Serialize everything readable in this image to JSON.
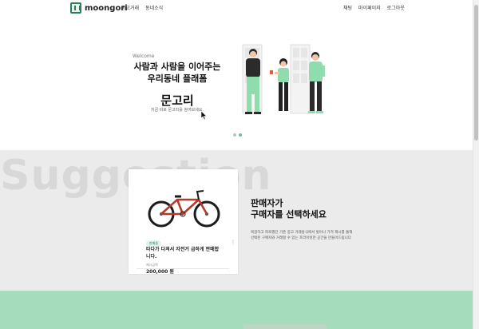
{
  "header": {
    "brand_name": "moongori",
    "nav_left": [
      "중고거래",
      "동네소식"
    ],
    "nav_right": [
      "채팅",
      "마이페이지",
      "로그아웃"
    ]
  },
  "hero": {
    "welcome": "Welcome",
    "title_line1": "사람과 사람을 이어주는",
    "title_line2": "우리동네 플래폼",
    "brand": "문고리",
    "subtitle": "지금 바로 문고리를 참여보세요.",
    "slide_count": 2,
    "active_slide": 2
  },
  "suggestion": {
    "background_word": "Suggestion",
    "card": {
      "badge": "판매중",
      "title": "타다가 다쳐서 자전거 급하게 판매합니다.",
      "price_label": "제시금액",
      "price": "200,000 원"
    },
    "heading_line1": "판매자가",
    "heading_line2": "구매자를 선택하세요",
    "description": "복잡하고 피로했던 기존 중고 거래방식에서 벗어나 가격 제시를 통해 선택된 구매자와 거래할 수 있는 프라이빗한 공간을 만들어드립니다"
  },
  "colors": {
    "brand_green": "#2e7d5b",
    "band_green": "#a5ddbc",
    "section_gray": "#ebebeb"
  }
}
